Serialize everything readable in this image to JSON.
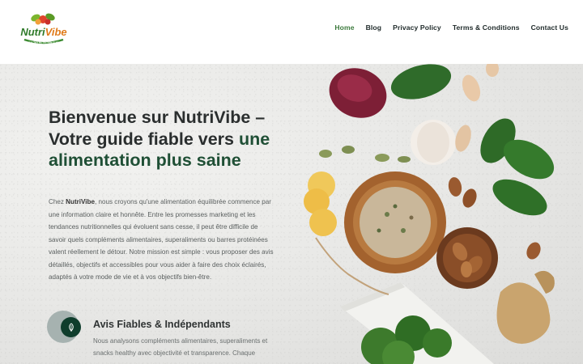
{
  "brand": {
    "name": "NutriVibe",
    "tagline": "HEALTHY NUTRITION GUIDE"
  },
  "nav": {
    "items": [
      {
        "label": "Home",
        "active": true
      },
      {
        "label": "Blog"
      },
      {
        "label": "Privacy Policy"
      },
      {
        "label": "Terms & Conditions"
      },
      {
        "label": "Contact Us"
      }
    ]
  },
  "hero": {
    "title_part1": "Bienvenue sur NutriVibe – Votre guide fiable vers",
    "title_accent": "une alimentation plus saine",
    "intro_prefix": "Chez ",
    "intro_brand": "NutriVibe",
    "intro_rest": ", nous croyons qu'une alimentation équilibrée commence par une information claire et honnête. Entre les promesses marketing et les tendances nutritionnelles qui évoluent sans cesse, il peut être difficile de savoir quels compléments alimentaires, superaliments ou barres protéinées valent réellement le détour. Notre mission est simple : vous proposer des avis détaillés, objectifs et accessibles pour vous aider à faire des choix éclairés, adaptés à votre mode de vie et à vos objectifs bien-être."
  },
  "feature": {
    "icon": "leaf-icon",
    "title": "Avis Fiables & Indépendants",
    "text": "Nous analysons compléments alimentaires, superaliments et snacks healthy avec objectivité et transparence. Chaque"
  },
  "colors": {
    "accent_green": "#3c7a3d",
    "dark_green": "#1f4f35",
    "icon_bg": "#0f3d2c"
  }
}
